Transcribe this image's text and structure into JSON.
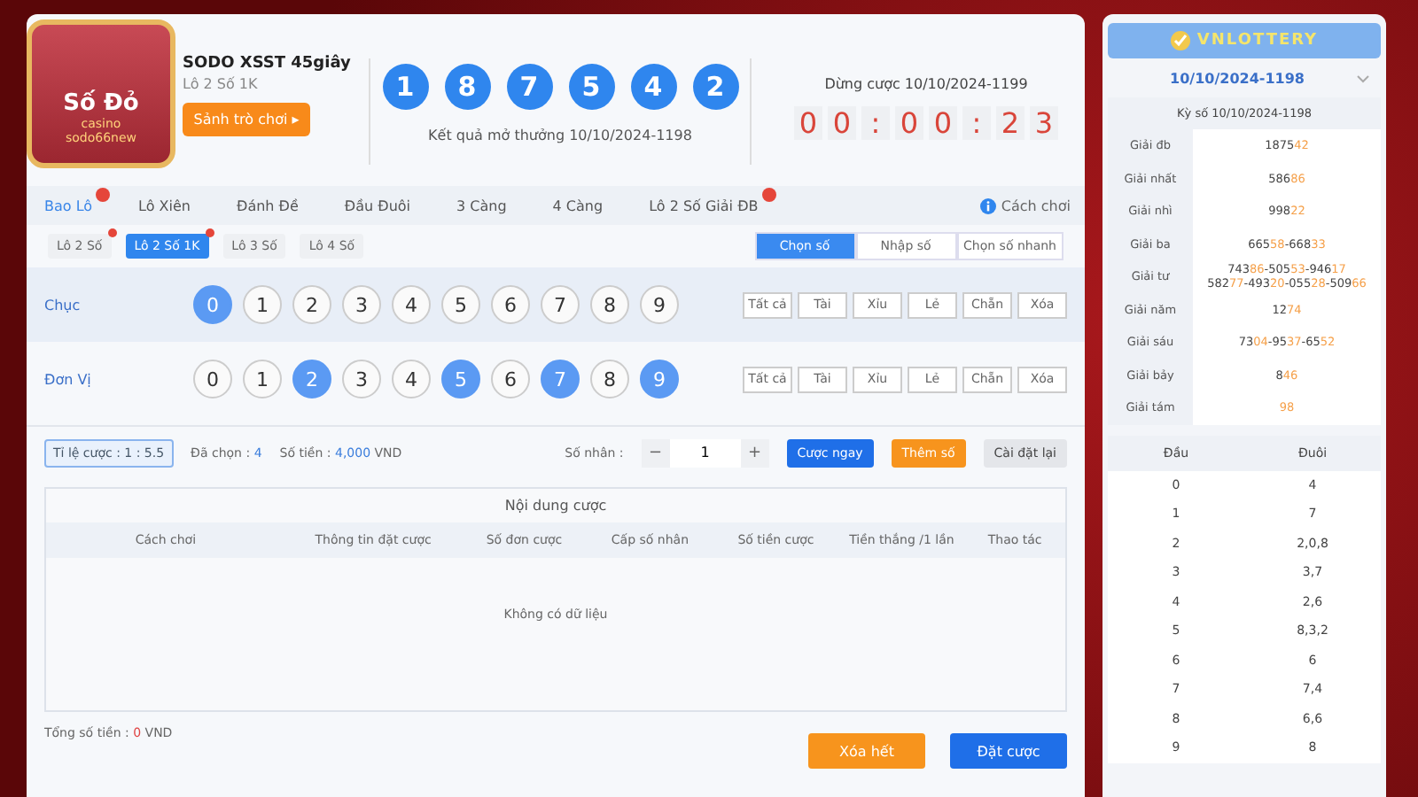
{
  "logo": {
    "brand": "Số Đỏ",
    "sub": "casino",
    "site": "sodo66new"
  },
  "game": {
    "title": "SODO XSST 45giây",
    "subtitle": "Lô 2 Số 1K",
    "lobby_button": "Sảnh trò chơi ▸"
  },
  "result": {
    "balls": [
      "1",
      "8",
      "7",
      "5",
      "4",
      "2"
    ],
    "caption": "Kết quả mở thưởng 10/10/2024-1198"
  },
  "countdown": {
    "label": "Dừng cược 10/10/2024-1199",
    "digits": [
      "0",
      "0",
      ":",
      "0",
      "0",
      ":",
      "2",
      "3"
    ]
  },
  "tabs": [
    {
      "label": "Bao Lô",
      "selected": true,
      "hot": true
    },
    {
      "label": "Lô Xiên",
      "selected": false,
      "hot": false
    },
    {
      "label": "Đánh Đề",
      "selected": false,
      "hot": false
    },
    {
      "label": "Đầu Đuôi",
      "selected": false,
      "hot": false
    },
    {
      "label": "3 Càng",
      "selected": false,
      "hot": false
    },
    {
      "label": "4 Càng",
      "selected": false,
      "hot": false
    },
    {
      "label": "Lô 2 Số Giải ĐB",
      "selected": false,
      "hot": true
    }
  ],
  "how_to_play": "Cách chơi",
  "subtabs": [
    {
      "label": "Lô 2 Số",
      "selected": false,
      "hot": true
    },
    {
      "label": "Lô 2 Số 1K",
      "selected": true,
      "hot": true
    },
    {
      "label": "Lô 3 Số",
      "selected": false,
      "hot": false
    },
    {
      "label": "Lô 4 Số",
      "selected": false,
      "hot": false
    }
  ],
  "modes": [
    {
      "label": "Chọn số",
      "selected": true
    },
    {
      "label": "Nhập số",
      "selected": false
    },
    {
      "label": "Chọn số nhanh",
      "selected": false
    }
  ],
  "rows": [
    {
      "label": "Chục",
      "balls": [
        {
          "n": "0",
          "selected": true
        },
        {
          "n": "1",
          "selected": false
        },
        {
          "n": "2",
          "selected": false
        },
        {
          "n": "3",
          "selected": false
        },
        {
          "n": "4",
          "selected": false
        },
        {
          "n": "5",
          "selected": false
        },
        {
          "n": "6",
          "selected": false
        },
        {
          "n": "7",
          "selected": false
        },
        {
          "n": "8",
          "selected": false
        },
        {
          "n": "9",
          "selected": false
        }
      ],
      "quick": [
        "Tất cả",
        "Tài",
        "Xỉu",
        "Lẻ",
        "Chẵn",
        "Xóa"
      ]
    },
    {
      "label": "Đơn Vị",
      "balls": [
        {
          "n": "0",
          "selected": false
        },
        {
          "n": "1",
          "selected": false
        },
        {
          "n": "2",
          "selected": true
        },
        {
          "n": "3",
          "selected": false
        },
        {
          "n": "4",
          "selected": false
        },
        {
          "n": "5",
          "selected": true
        },
        {
          "n": "6",
          "selected": false
        },
        {
          "n": "7",
          "selected": true
        },
        {
          "n": "8",
          "selected": false
        },
        {
          "n": "9",
          "selected": true
        }
      ],
      "quick": [
        "Tất cả",
        "Tài",
        "Xỉu",
        "Lẻ",
        "Chẵn",
        "Xóa"
      ]
    }
  ],
  "bet_bar": {
    "odds": "Tỉ lệ cược : 1 : 5.5",
    "chosen_label": "Đã chọn :",
    "chosen": "4",
    "amount_label": "Số tiền :",
    "amount": "4,000",
    "currency": "VND",
    "multiplier_label": "Số nhân :",
    "minus": "−",
    "multiplier": "1",
    "plus": "+",
    "buttons": [
      {
        "label": "Cược ngay",
        "kind": "primary"
      },
      {
        "label": "Thêm số",
        "kind": "warn"
      },
      {
        "label": "Cài đặt lại",
        "kind": "plain"
      }
    ]
  },
  "table": {
    "title": "Nội dung cược",
    "columns": [
      "Cách chơi",
      "Thông tin đặt cược",
      "Số đơn cược",
      "Cấp số nhân",
      "Số tiền cược",
      "Tiền thắng /1 lần",
      "Thao tác"
    ],
    "empty": "Không có dữ liệu"
  },
  "footer": {
    "total_label": "Tổng số tiền :",
    "total": "0",
    "currency": "VND",
    "buttons": [
      {
        "label": "Xóa hết",
        "kind": "warn"
      },
      {
        "label": "Đặt cược",
        "kind": "primary"
      }
    ]
  },
  "side": {
    "logo": "VNLOTTERY",
    "draw": "10/10/2024-1198",
    "period": "Kỳ số 10/10/2024-1198",
    "prizes": [
      {
        "name": "Giải đb",
        "lines": [
          [
            {
              "t": "1875",
              "hot": false
            },
            {
              "t": "42",
              "hot": true
            }
          ]
        ]
      },
      {
        "name": "Giải nhất",
        "lines": [
          [
            {
              "t": "586",
              "hot": false
            },
            {
              "t": "86",
              "hot": true
            }
          ]
        ]
      },
      {
        "name": "Giải nhì",
        "lines": [
          [
            {
              "t": "998",
              "hot": false
            },
            {
              "t": "22",
              "hot": true
            }
          ]
        ]
      },
      {
        "name": "Giải ba",
        "lines": [
          [
            {
              "t": "665",
              "hot": false
            },
            {
              "t": "58",
              "hot": true
            },
            {
              "t": "-668",
              "hot": false
            },
            {
              "t": "33",
              "hot": true
            }
          ]
        ]
      },
      {
        "name": "Giải tư",
        "lines": [
          [
            {
              "t": "743",
              "hot": false
            },
            {
              "t": "86",
              "hot": true
            },
            {
              "t": "-505",
              "hot": false
            },
            {
              "t": "53",
              "hot": true
            },
            {
              "t": "-946",
              "hot": false
            },
            {
              "t": "17",
              "hot": true
            }
          ],
          [
            {
              "t": "582",
              "hot": false
            },
            {
              "t": "77",
              "hot": true
            },
            {
              "t": "-493",
              "hot": false
            },
            {
              "t": "20",
              "hot": true
            },
            {
              "t": "-055",
              "hot": false
            },
            {
              "t": "28",
              "hot": true
            },
            {
              "t": "-509",
              "hot": false
            },
            {
              "t": "66",
              "hot": true
            }
          ]
        ]
      },
      {
        "name": "Giải năm",
        "lines": [
          [
            {
              "t": "12",
              "hot": false
            },
            {
              "t": "74",
              "hot": true
            }
          ]
        ]
      },
      {
        "name": "Giải sáu",
        "lines": [
          [
            {
              "t": "73",
              "hot": false
            },
            {
              "t": "04",
              "hot": true
            },
            {
              "t": "-95",
              "hot": false
            },
            {
              "t": "37",
              "hot": true
            },
            {
              "t": "-65",
              "hot": false
            },
            {
              "t": "52",
              "hot": true
            }
          ]
        ]
      },
      {
        "name": "Giải bảy",
        "lines": [
          [
            {
              "t": "8",
              "hot": false
            },
            {
              "t": "46",
              "hot": true
            }
          ]
        ]
      },
      {
        "name": "Giải tám",
        "lines": [
          [
            {
              "t": "98",
              "hot": true
            }
          ]
        ]
      }
    ],
    "head_tail": {
      "columns": [
        "Đầu",
        "Đuôi"
      ],
      "rows": [
        [
          "0",
          "4"
        ],
        [
          "1",
          "7"
        ],
        [
          "2",
          "2,0,8"
        ],
        [
          "3",
          "3,7"
        ],
        [
          "4",
          "2,6"
        ],
        [
          "5",
          "8,3,2"
        ],
        [
          "6",
          "6"
        ],
        [
          "7",
          "7,4"
        ],
        [
          "8",
          "6,6"
        ],
        [
          "9",
          "8"
        ]
      ]
    }
  }
}
